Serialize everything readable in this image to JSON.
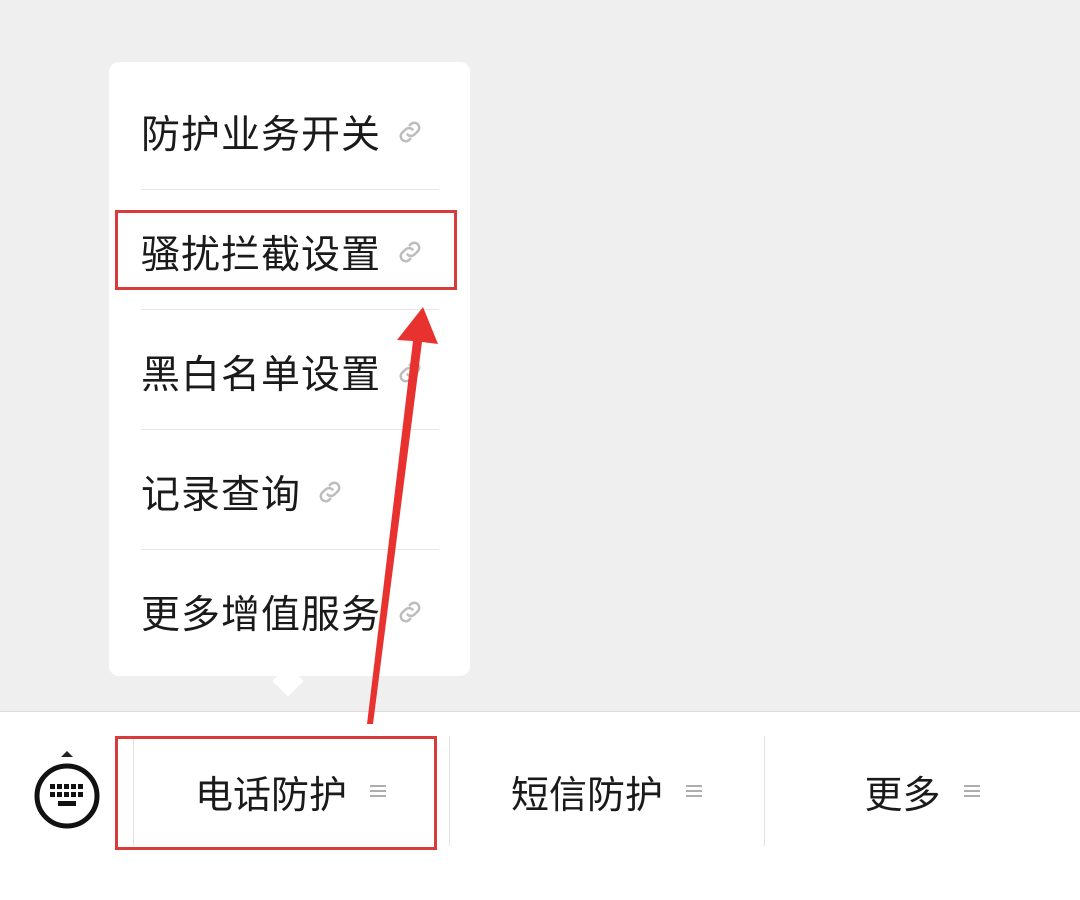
{
  "popup_menu": {
    "items": [
      {
        "label": "防护业务开关",
        "icon": "link-icon"
      },
      {
        "label": "骚扰拦截设置",
        "icon": "link-icon"
      },
      {
        "label": "黑白名单设置",
        "icon": "link-icon"
      },
      {
        "label": "记录查询",
        "icon": "link-icon"
      },
      {
        "label": "更多增值服务",
        "icon": "link-icon"
      }
    ]
  },
  "bottom_menu": {
    "keyboard_icon": "keyboard-icon",
    "tabs": [
      {
        "label": "电话防护",
        "icon": "menu-lines-icon"
      },
      {
        "label": "短信防护",
        "icon": "menu-lines-icon"
      },
      {
        "label": "更多",
        "icon": "menu-lines-icon"
      }
    ]
  },
  "colors": {
    "annotation_red": "#d93a3a",
    "background": "#efefef"
  }
}
